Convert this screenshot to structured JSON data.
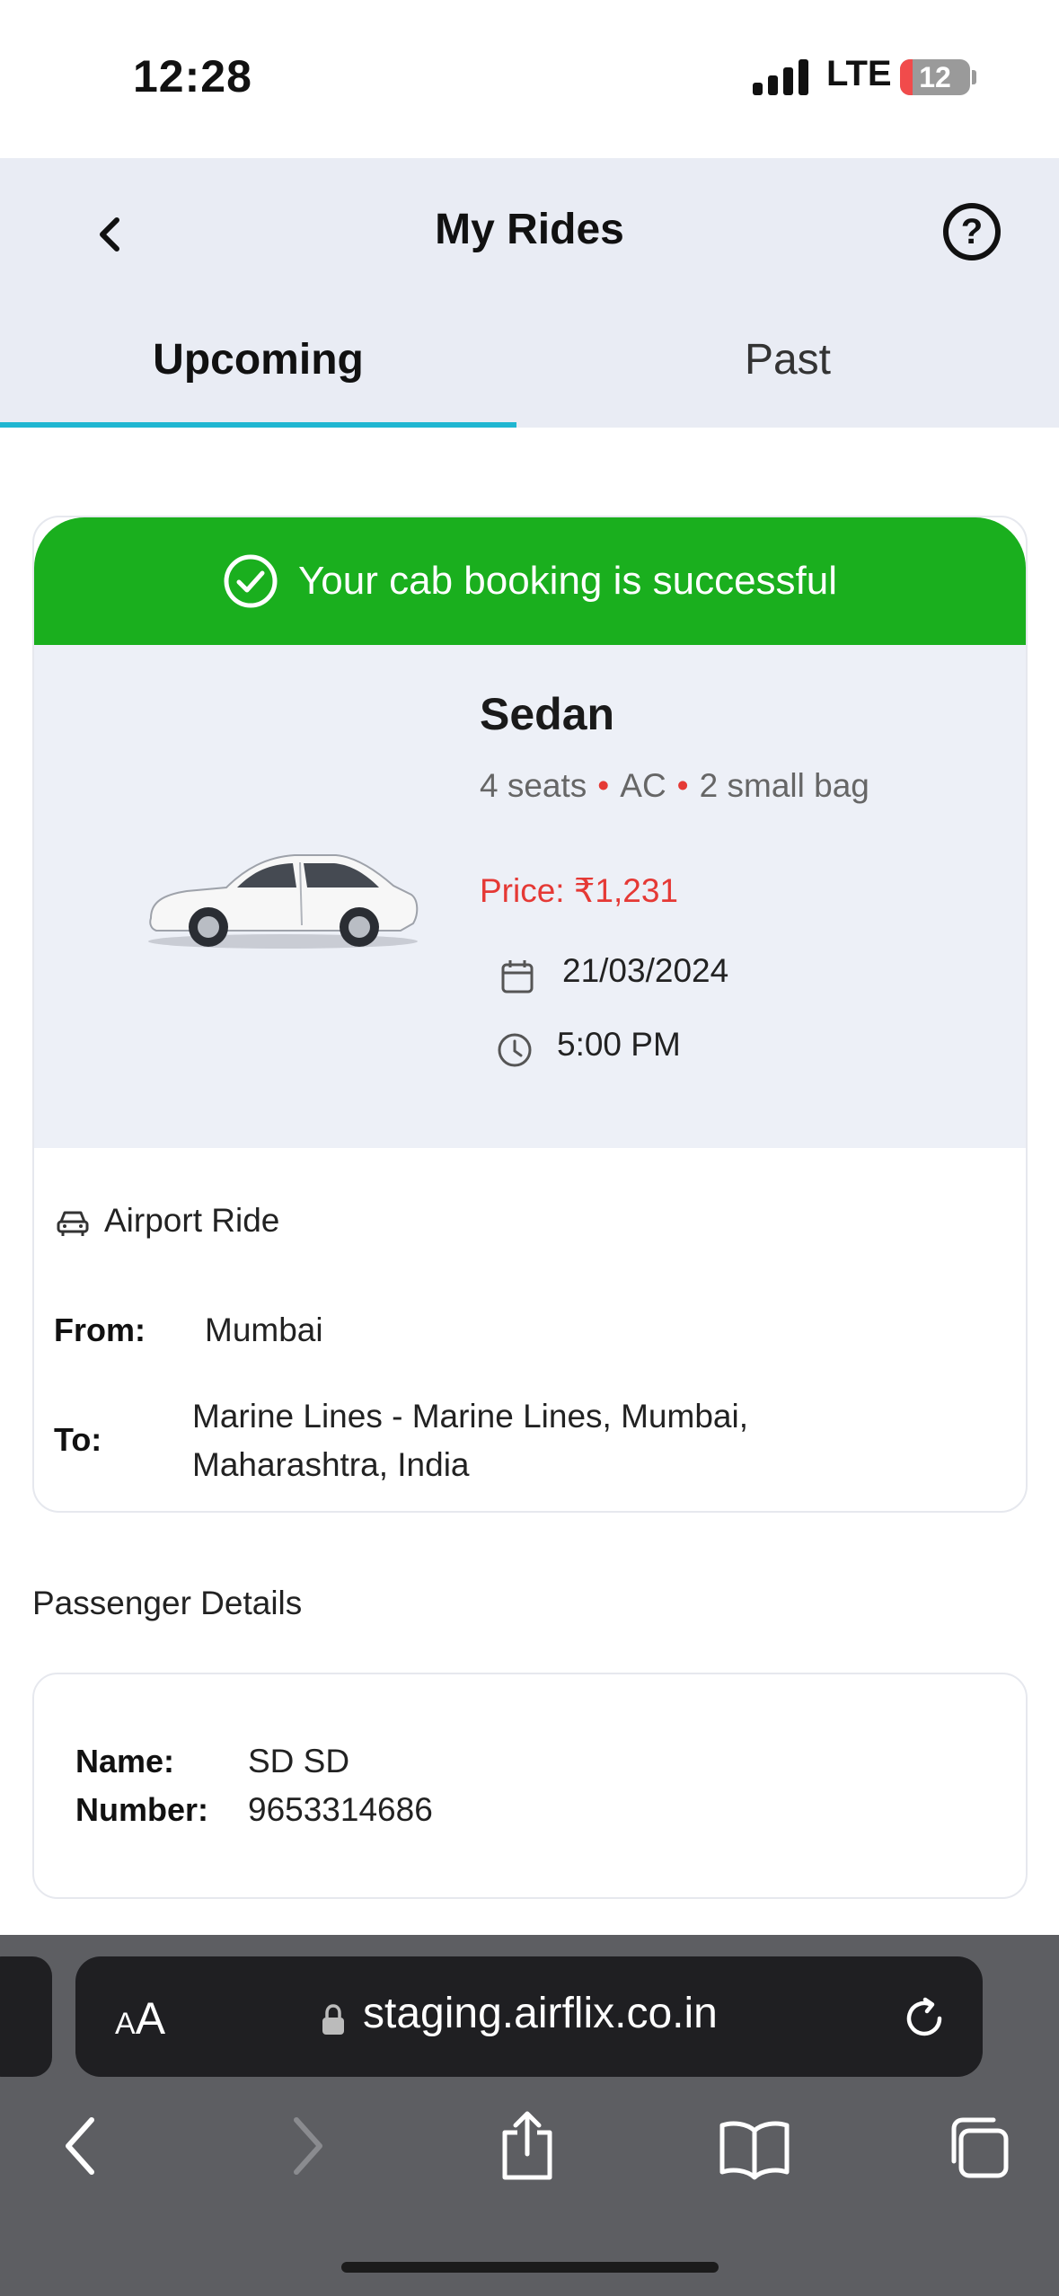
{
  "status_bar": {
    "time": "12:28",
    "network": "LTE",
    "battery": "12"
  },
  "header": {
    "title": "My Rides"
  },
  "tabs": [
    {
      "label": "Upcoming"
    },
    {
      "label": "Past"
    }
  ],
  "booking": {
    "success_message": "Your cab booking is successful",
    "car_type": "Sedan",
    "features": [
      "4 seats",
      "AC",
      "2 small bag"
    ],
    "price": "Price: ₹1,231",
    "date": "21/03/2024",
    "time": "5:00 PM",
    "ride_type": "Airport Ride",
    "from_label": "From:",
    "from": "Mumbai",
    "to_label": "To:",
    "to": "Marine Lines - Marine Lines, Mumbai, Maharashtra, India"
  },
  "passenger": {
    "heading": "Passenger Details",
    "name_label": "Name:",
    "name": "SD SD",
    "number_label": "Number:",
    "number": "9653314686"
  },
  "browser": {
    "aa_small": "A",
    "aa_large": "A",
    "url": "staging.airflix.co.in"
  },
  "colors": {
    "accent": "#1fb6d1",
    "success": "#1aaf1e",
    "price": "#e53935",
    "header_bg": "#e9ecf4"
  }
}
